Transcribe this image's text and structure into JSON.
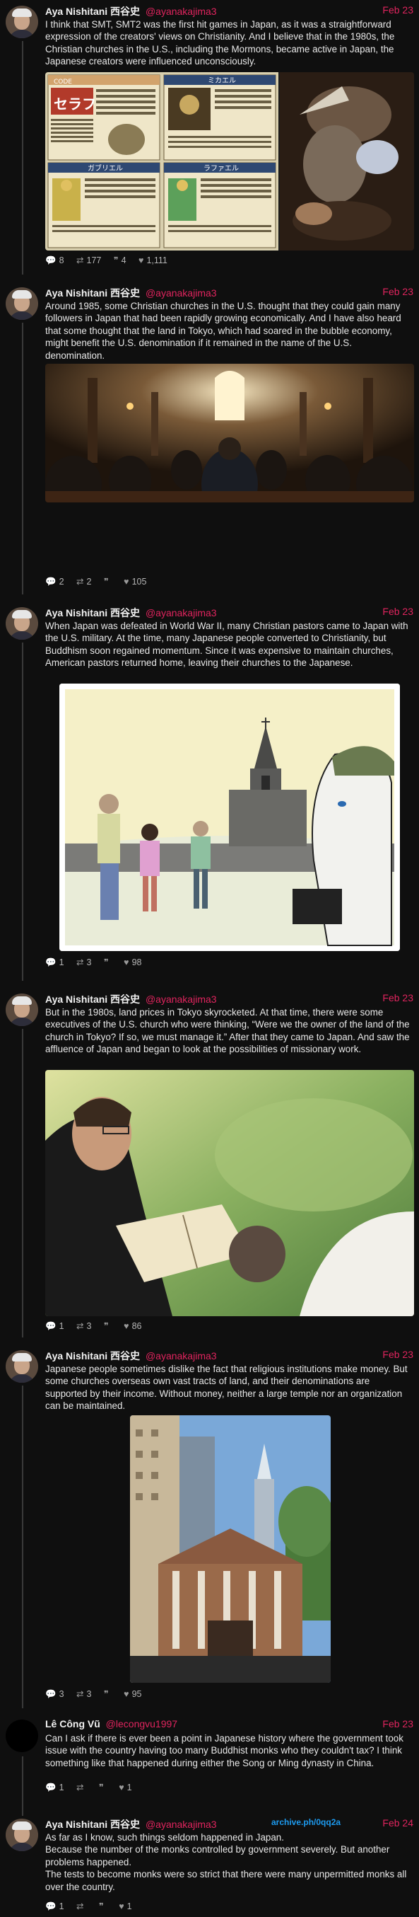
{
  "tweets": [
    {
      "author": "Aya Nishitani 西谷史",
      "handle": "@ayanakajima3",
      "date": "Feb 23",
      "text": "I think that SMT, SMT2 was the first hit games in Japan, as it was a straightforward expression of the creators' views on Christianity. And I believe that in the 1980s, the Christian churches in the U.S., including the Mormons, became active in Japan, the Japanese creators were influenced unconsciously.",
      "stats": {
        "replies": "8",
        "retweets": "177",
        "quotes": "4",
        "likes": "1,111"
      },
      "media": {
        "cards": [
          {
            "title": "セラフ",
            "tag": "CODE"
          },
          {
            "title": "ミカエル",
            "tag": ""
          },
          {
            "title": "ガブリエル",
            "tag": ""
          },
          {
            "title": "ラファエル",
            "tag": ""
          }
        ]
      }
    },
    {
      "author": "Aya Nishitani 西谷史",
      "handle": "@ayanakajima3",
      "date": "Feb 23",
      "text": "Around 1985, some Christian churches in the U.S. thought that they could gain many followers in Japan that had been rapidly growing economically. And I have also heard that some thought that the land in Tokyo, which had soared in the bubble economy, might benefit the U.S. denomination if it remained in the name of the U.S. denomination.",
      "stats": {
        "replies": "2",
        "retweets": "2",
        "quotes": "",
        "likes": "105"
      }
    },
    {
      "author": "Aya Nishitani 西谷史",
      "handle": "@ayanakajima3",
      "date": "Feb 23",
      "text": "When Japan was defeated in World War II, many Christian pastors came to Japan with the U.S. military. At the time, many Japanese people converted to Christianity, but Buddhism soon regained momentum. Since it was expensive to maintain churches, American pastors returned home, leaving their churches to the Japanese.",
      "stats": {
        "replies": "1",
        "retweets": "3",
        "quotes": "",
        "likes": "98"
      }
    },
    {
      "author": "Aya Nishitani 西谷史",
      "handle": "@ayanakajima3",
      "date": "Feb 23",
      "text": "But in the 1980s, land prices in Tokyo skyrocketed. At that time, there were some executives of the U.S. church who were thinking, “Were we the owner of the land of the church in Tokyo? If so, we must manage it.” After that they came to Japan. And saw the affluence of Japan and began to look at the possibilities of missionary work.",
      "stats": {
        "replies": "1",
        "retweets": "3",
        "quotes": "",
        "likes": "86"
      }
    },
    {
      "author": "Aya Nishitani 西谷史",
      "handle": "@ayanakajima3",
      "date": "Feb 23",
      "text": "Japanese people sometimes dislike the fact that religious institutions make money. But some churches overseas own vast tracts of land, and their denominations are supported by their income. Without money, neither a large temple nor an organization can be maintained.",
      "stats": {
        "replies": "3",
        "retweets": "3",
        "quotes": "",
        "likes": "95"
      }
    },
    {
      "author": "Lê Công Vũ",
      "handle": "@lecongvu1997",
      "date": "Feb 23",
      "text": "Can I ask if there is ever been a point in Japanese history where the government took issue with the country having too many Buddhist monks who they couldn't tax? I think something like that happened during either the Song or Ming dynasty in China.",
      "stats": {
        "replies": "1",
        "retweets": "",
        "quotes": "",
        "likes": "1"
      }
    },
    {
      "author": "Aya Nishitani 西谷史",
      "handle": "@ayanakajima3",
      "date": "Feb 24",
      "archive": "archive.ph/0qq2a",
      "text_lines": [
        "As far as I know, such things seldom happened in Japan.",
        "Because the number of the monks controlled by government severely. But another problems happened.",
        "The tests to become monks were so strict that there were many unpermitted monks all over the country."
      ],
      "stats": {
        "replies": "1",
        "retweets": "",
        "quotes": "",
        "likes": "1"
      }
    }
  ],
  "icons": {
    "reply": "reply-icon",
    "retweet": "retweet-icon",
    "quote": "quote-icon",
    "like": "heart-icon"
  },
  "colors": {
    "background": "#0f0f0f",
    "accent": "#e0245e",
    "link": "#1d9bf0",
    "text": "#e8e8e8"
  }
}
